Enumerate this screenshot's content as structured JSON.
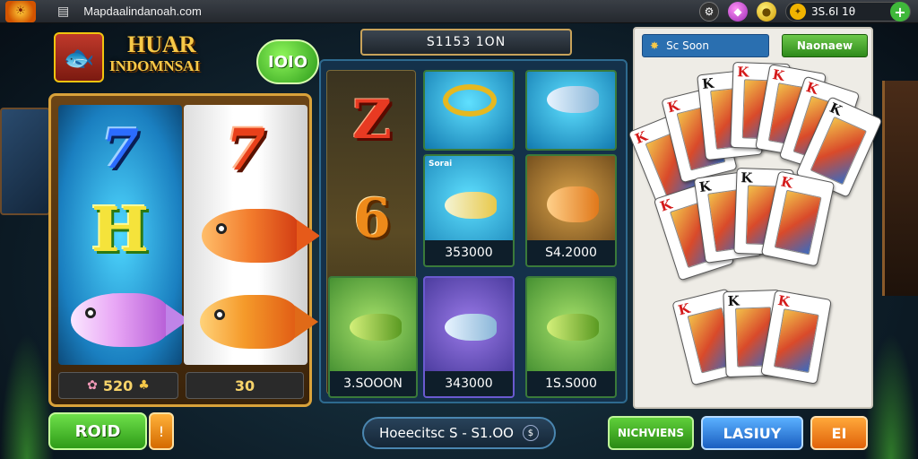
{
  "topbar": {
    "logo_icon": "sun-logo-icon",
    "menu_icon": "grid-menu-icon",
    "url": "Mapdaalindanoah.com",
    "settings_icon": "settings-icon",
    "gem_icon": "gem-icon",
    "coin_icon": "coin-icon",
    "balance_icon": "gold-bag-icon",
    "balance": "3S.6I 1θ",
    "balance_plus": "+"
  },
  "slot": {
    "logo_icon": "game-logo-icon",
    "title_line1": "HUAR",
    "title_line2": "INDOMNSAI",
    "badge": "IOIO",
    "reel_symbols": [
      "7",
      "H",
      "7"
    ],
    "stat1_value": "520",
    "stat2_value": "30",
    "play_label": "ROID",
    "mini_label": "!"
  },
  "grid": {
    "jackpot_label": "S1153 1ON",
    "numbers": [
      "Z",
      "6"
    ],
    "tiles": [
      {
        "tag": "",
        "label": ""
      },
      {
        "tag": "",
        "label": ""
      },
      {
        "tag": "Sorai",
        "label": "353000"
      },
      {
        "tag": "",
        "label": "S4.2000"
      },
      {
        "tag": "",
        "label": "3.SOOON"
      },
      {
        "tag": "",
        "label": "343000"
      },
      {
        "tag": "",
        "label": "1S.S000"
      }
    ],
    "bet_label": "Hoeecitsc S - S1.OO",
    "bet_info": "$"
  },
  "cards": {
    "search_text": "Sc Soon",
    "action_label": "Naonaew",
    "ranks": [
      "K",
      "K",
      "K",
      "K",
      "K",
      "K",
      "K",
      "K",
      "K",
      "K",
      "K",
      "K",
      "K",
      "K",
      "K",
      "K"
    ]
  },
  "bottom": {
    "green_label": "NICHVIENS",
    "blue_label": "LASIUY",
    "orange_label": "EI"
  }
}
